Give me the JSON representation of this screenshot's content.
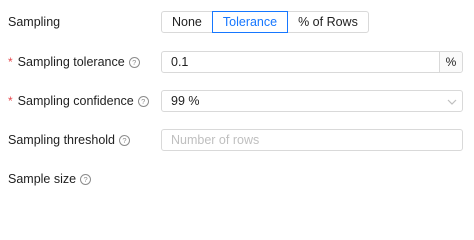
{
  "sampling": {
    "label": "Sampling",
    "options": [
      "None",
      "Tolerance",
      "% of Rows"
    ],
    "selected": "Tolerance"
  },
  "tolerance": {
    "label": "Sampling tolerance",
    "required": "*",
    "value": "0.1",
    "suffix": "%"
  },
  "confidence": {
    "label": "Sampling confidence",
    "required": "*",
    "value": "99 %"
  },
  "threshold": {
    "label": "Sampling threshold",
    "placeholder": "Number of rows"
  },
  "sample_size": {
    "label": "Sample size"
  },
  "help_glyph": "?",
  "accent_color": "#1677ff",
  "required_color": "#e5484d"
}
